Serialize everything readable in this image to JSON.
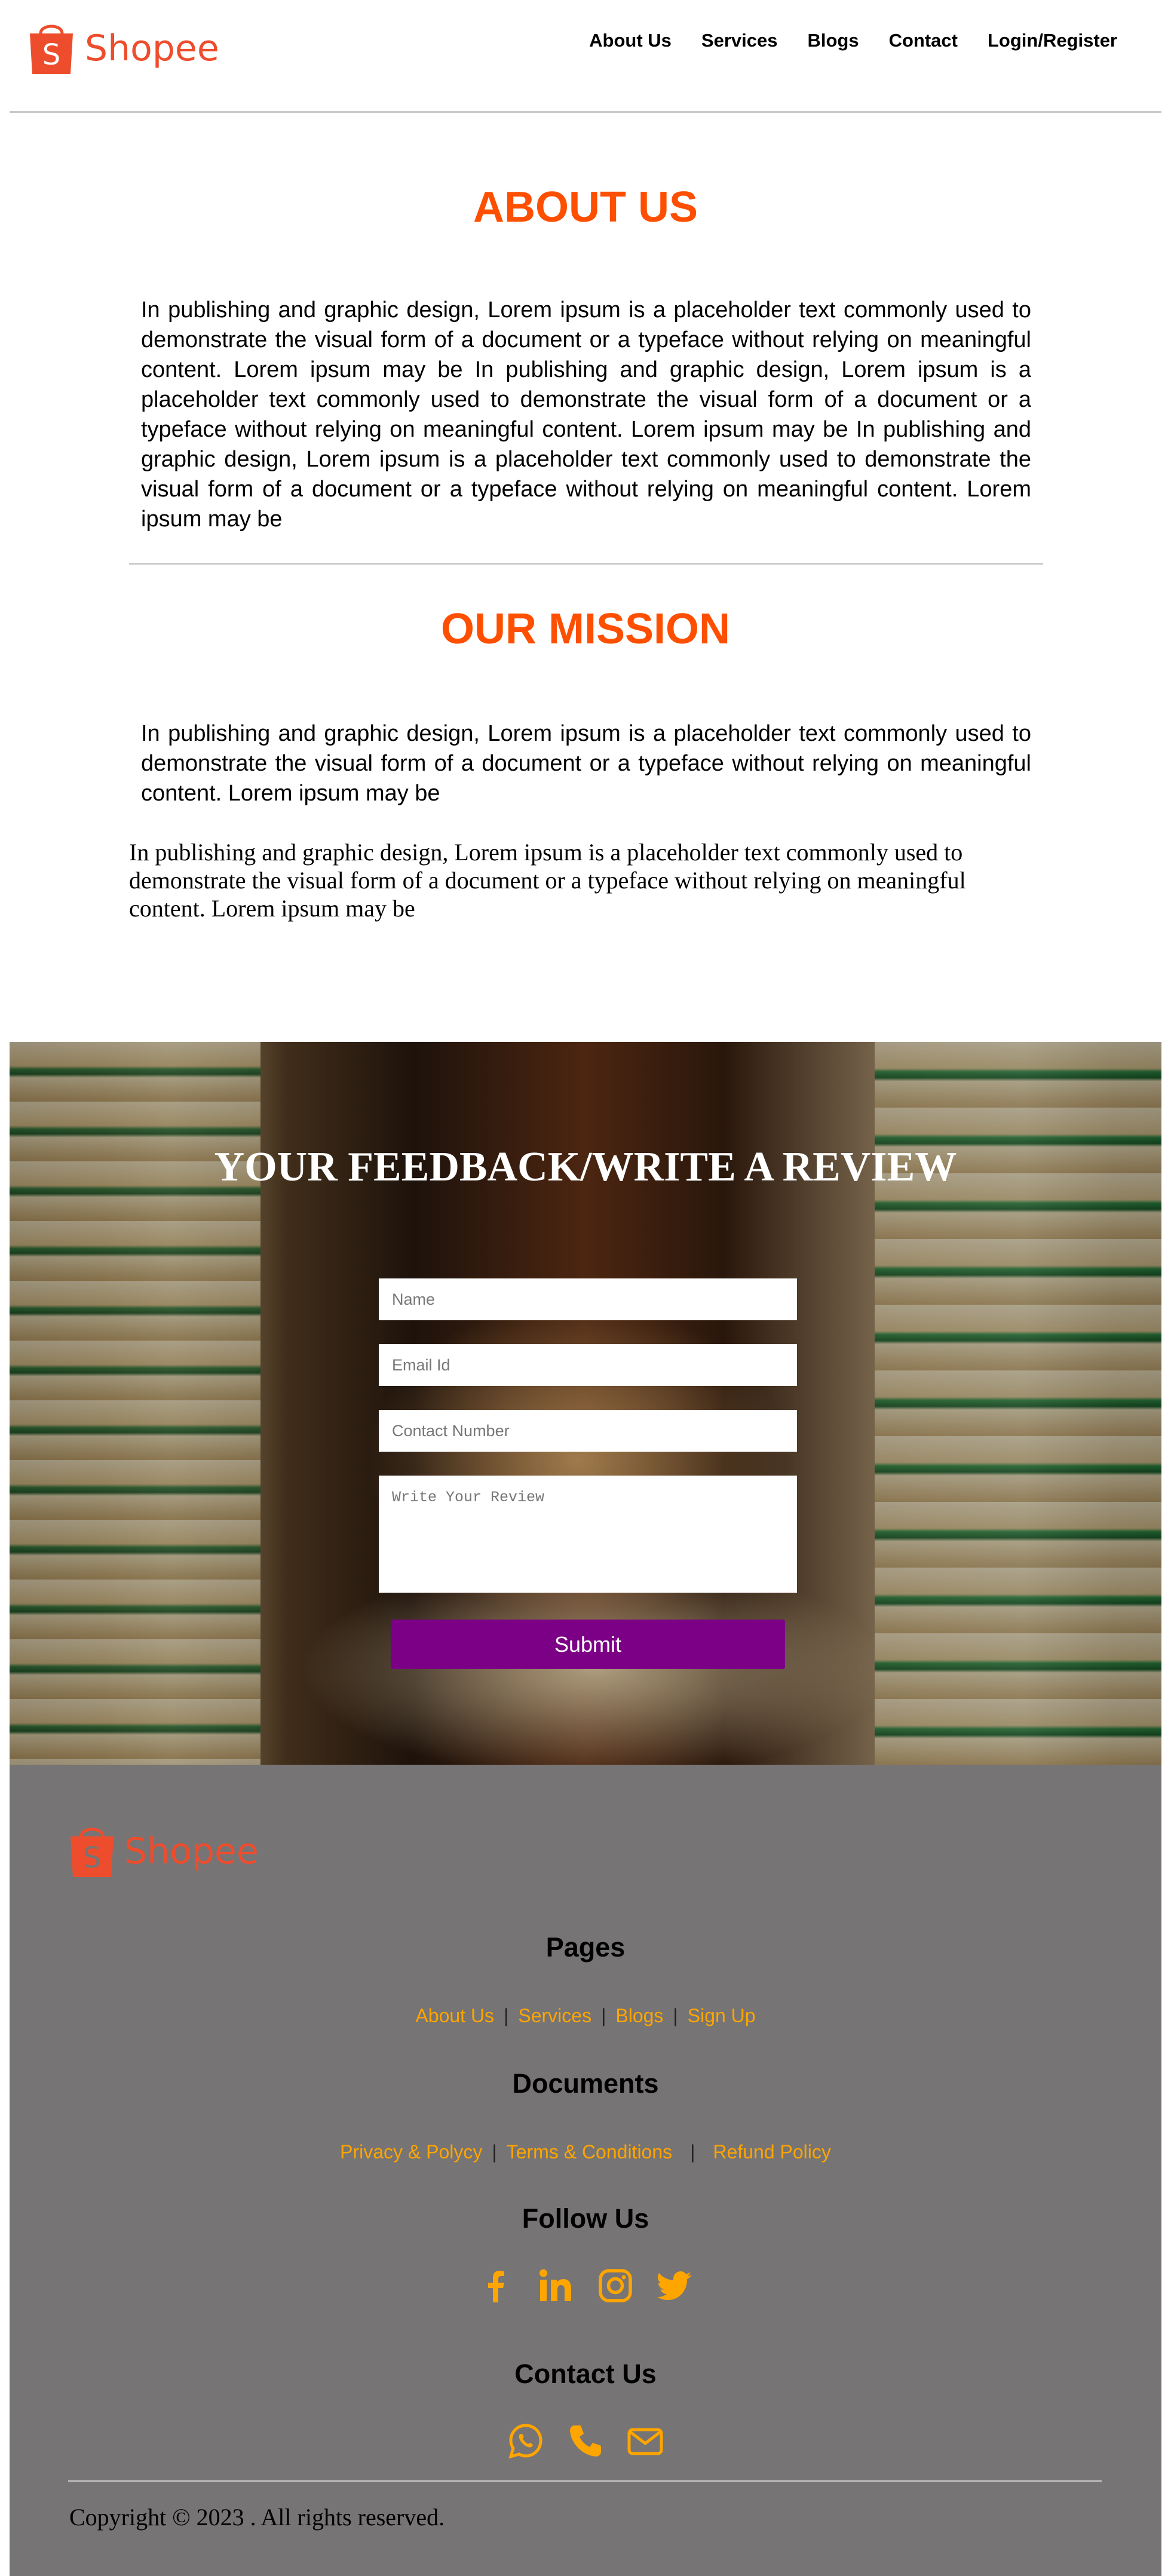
{
  "brand": {
    "name": "Shopee",
    "color": "#ee4d2d",
    "logo_letter": "S"
  },
  "nav": {
    "items": [
      "About Us",
      "Services",
      "Blogs",
      "Contact",
      "Login/Register"
    ]
  },
  "about": {
    "title": "ABOUT US",
    "text": "In publishing and graphic design, Lorem ipsum is a placeholder text commonly used to demonstrate the visual form of a document or a typeface without relying on meaningful content. Lorem ipsum may be In publishing and graphic design, Lorem ipsum is a placeholder text commonly used to demonstrate the visual form of a document or a typeface without relying on meaningful content. Lorem ipsum may be In publishing and graphic design, Lorem ipsum is a placeholder text commonly used to demonstrate the visual form of a document or a typeface without relying on meaningful content. Lorem ipsum may be"
  },
  "mission": {
    "title": "OUR MISSION",
    "text": "In publishing and graphic design, Lorem ipsum is a placeholder text commonly used to demonstrate the visual form of a document or a typeface without relying on meaningful content. Lorem ipsum may be",
    "text_secondary": "In publishing and graphic design, Lorem ipsum is a placeholder text commonly used to demonstrate the visual form of a document or a typeface without relying on meaningful content. Lorem ipsum may be"
  },
  "feedback": {
    "title": "YOUR FEEDBACK/WRITE A REVIEW",
    "name_placeholder": "Name",
    "email_placeholder": "Email Id",
    "contact_placeholder": "Contact Number",
    "review_placeholder": "Write Your Review",
    "submit_label": "Submit",
    "submit_color": "#7b0085"
  },
  "footer": {
    "pages_heading": "Pages",
    "pages_links": [
      "About Us",
      "Services",
      "Blogs",
      "Sign Up"
    ],
    "documents_heading": "Documents",
    "documents_links": [
      "Privacy & Polycy",
      "Terms & Conditions",
      "Refund Policy"
    ],
    "follow_heading": "Follow Us",
    "social_icons": [
      "facebook-icon",
      "linkedin-icon",
      "instagram-icon",
      "twitter-icon"
    ],
    "contact_heading": "Contact Us",
    "contact_icons": [
      "whatsapp-icon",
      "phone-icon",
      "email-icon"
    ],
    "link_color": "#ffa500",
    "background": "#767474",
    "copyright": "Copyright © 2023 . All rights reserved."
  }
}
